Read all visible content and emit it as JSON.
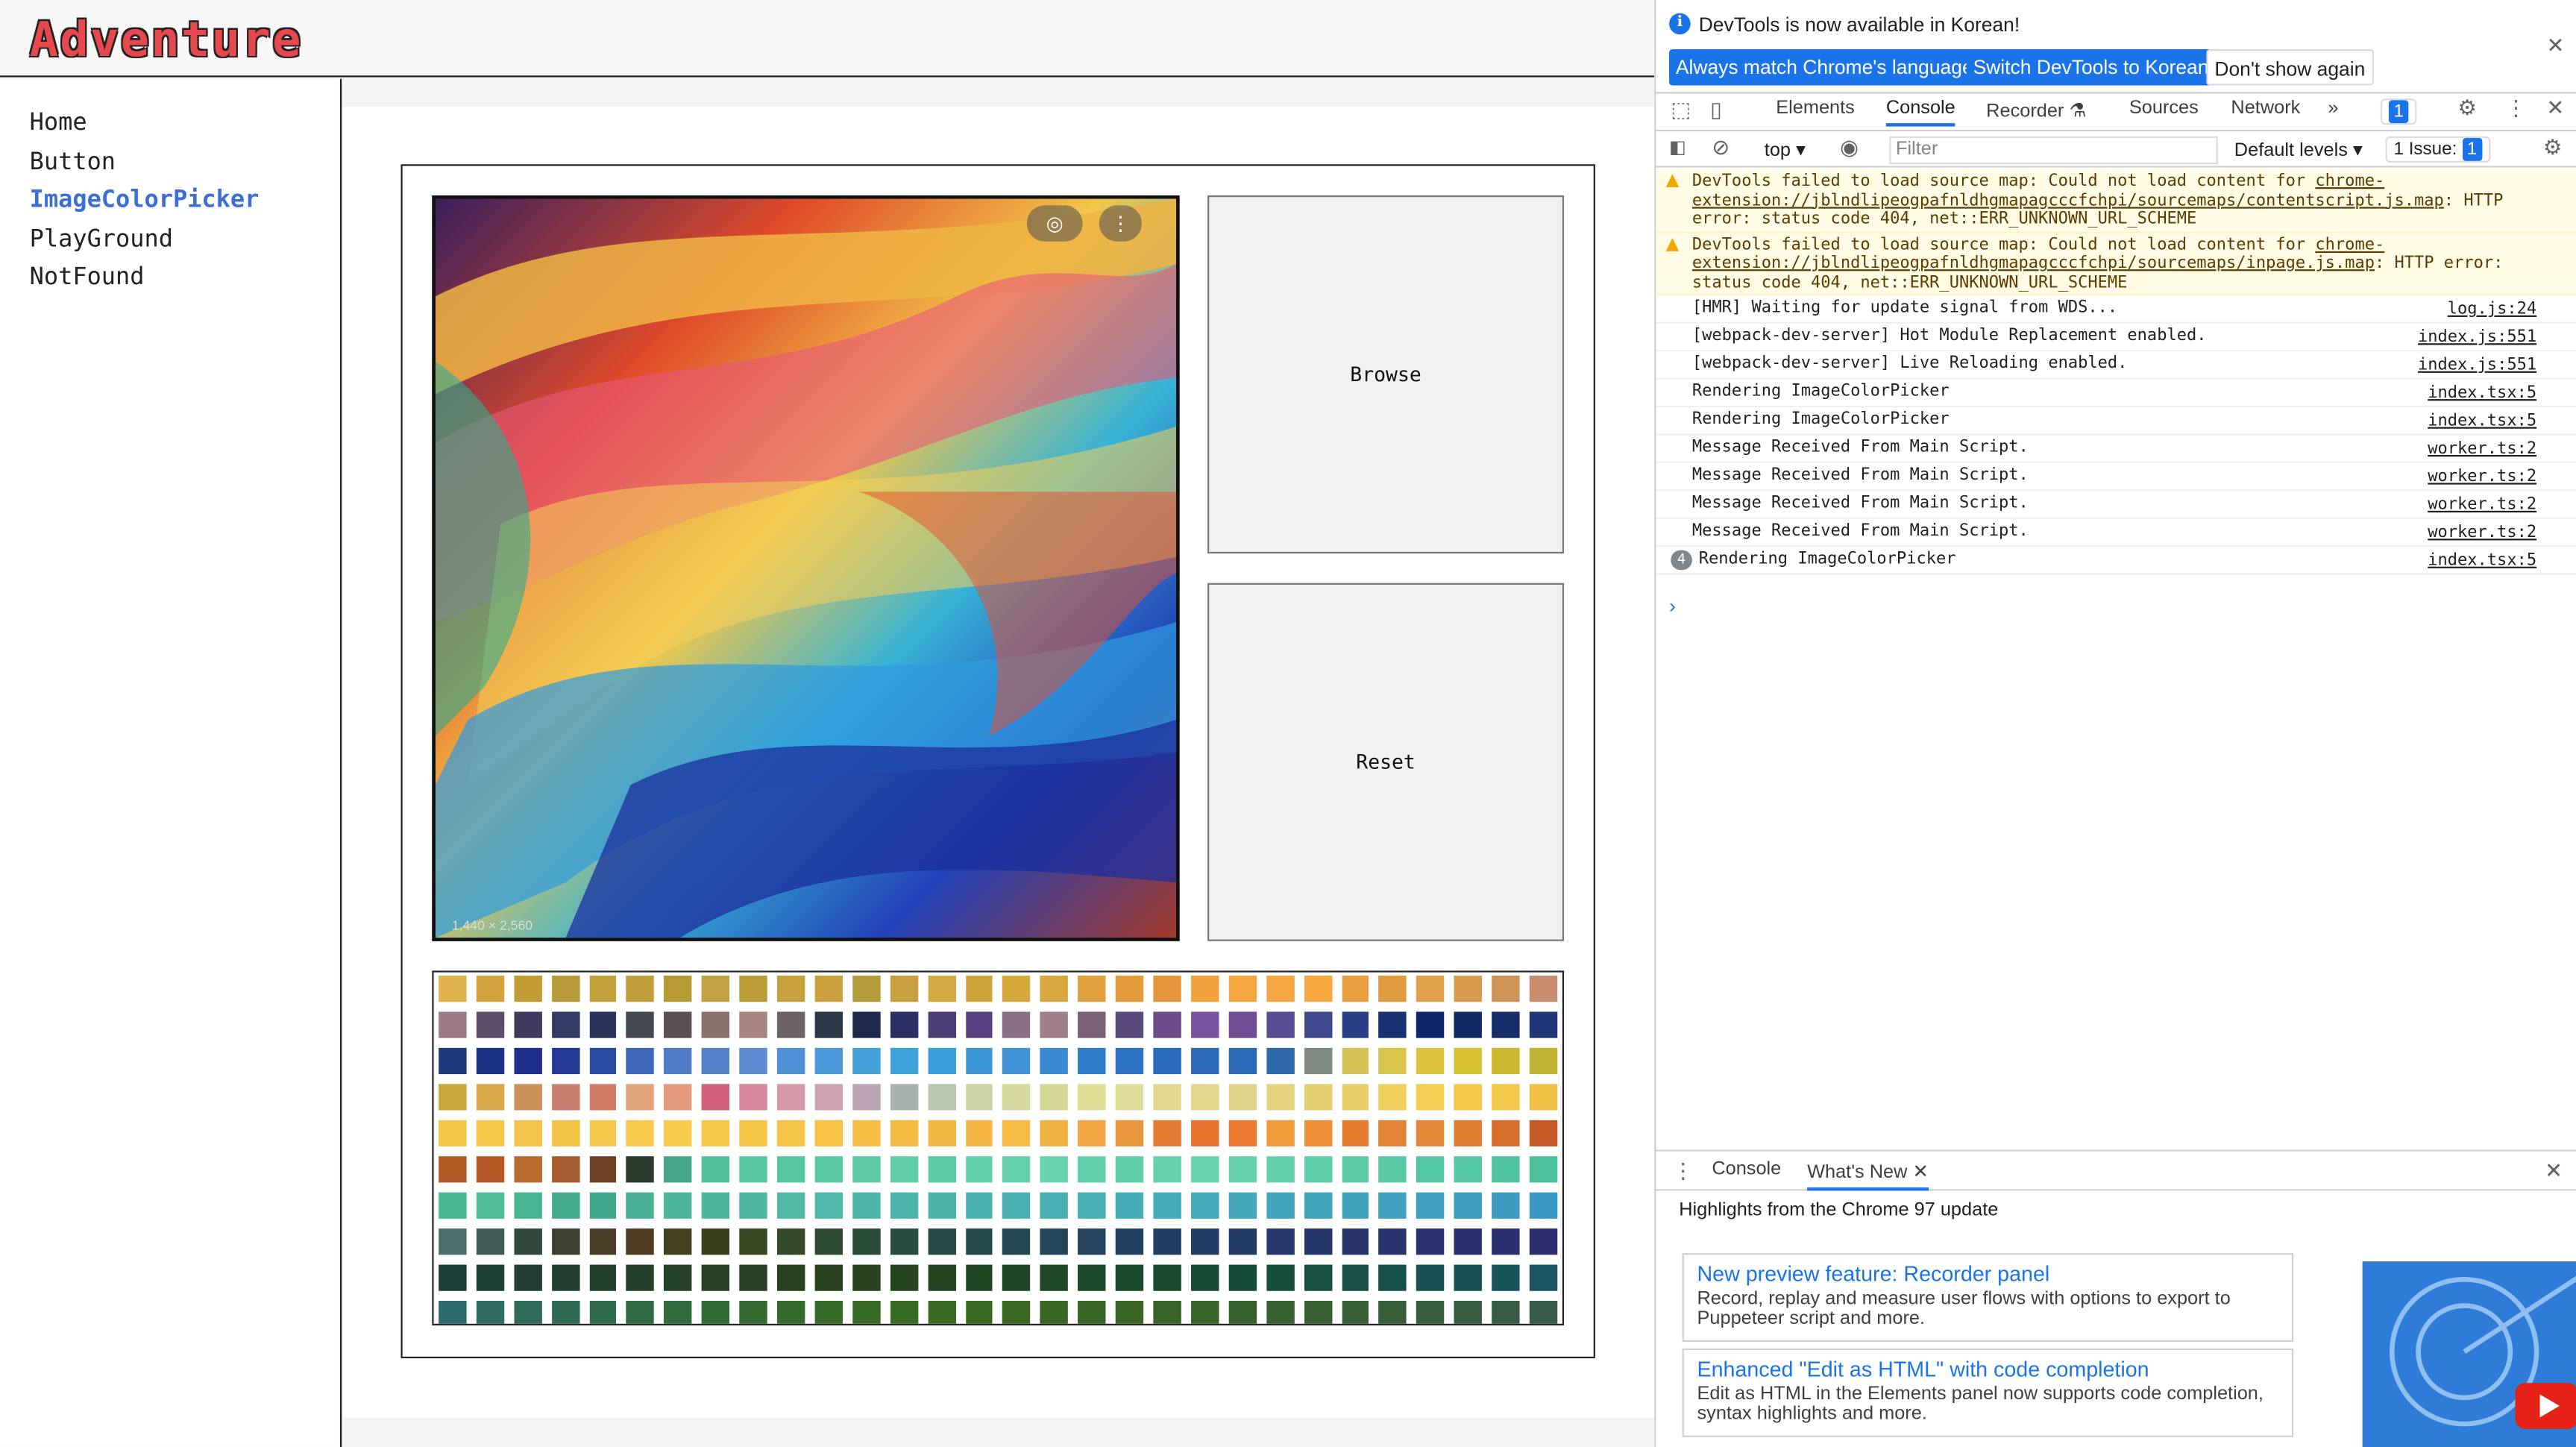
{
  "app": {
    "brand": "Adventure",
    "nav": [
      {
        "label": "Home",
        "active": false
      },
      {
        "label": "Button",
        "active": false
      },
      {
        "label": "ImageColorPicker",
        "active": true
      },
      {
        "label": "PlayGround",
        "active": false
      },
      {
        "label": "NotFound",
        "active": false
      }
    ],
    "picker": {
      "image_size_label": "1,440 × 2,560",
      "browse_label": "Browse",
      "reset_label": "Reset",
      "palette_rows": [
        [
          "#e0b44c",
          "#d3a43d",
          "#c29c33",
          "#b79b3a",
          "#c1a03a",
          "#c09e3a",
          "#b59a34",
          "#bfa043",
          "#b99c36",
          "#c7a13c",
          "#caa13d",
          "#b69b3a",
          "#c8a03f",
          "#d3a943",
          "#cda43a",
          "#d5a83c",
          "#d9a740",
          "#dfa03d",
          "#e39b3c",
          "#e5963c",
          "#f2a23c",
          "#f5a742",
          "#f6a744",
          "#f7a83f",
          "#e89f3e",
          "#df9c3e",
          "#e2a04b",
          "#d89b4d",
          "#cf9257",
          "#c88d6f"
        ],
        [
          "#9a7a86",
          "#5c4e6b",
          "#3f3b5f",
          "#2f3b63",
          "#2a335a",
          "#444851",
          "#5c4f55",
          "#8a6f6b",
          "#a7847d",
          "#6d6268",
          "#2c3848",
          "#1d2a4c",
          "#2a2f64",
          "#4d3d77",
          "#584080",
          "#8b6f88",
          "#9f7f88",
          "#7a5f79",
          "#5a4a7c",
          "#6c4c89",
          "#7c53a0",
          "#714d95",
          "#5a4c93",
          "#3e4a8d",
          "#283e86",
          "#173173",
          "#10266c",
          "#0f2a63",
          "#182c6c",
          "#213677"
        ],
        [
          "#1e3a7a",
          "#1a3283",
          "#1f2d8d",
          "#233894",
          "#2a4ba3",
          "#3d67b8",
          "#4e7cc8",
          "#5382cb",
          "#5c8bd4",
          "#4f90d7",
          "#4a99da",
          "#46a1db",
          "#3fa2dd",
          "#3c9edc",
          "#3d96d5",
          "#3f95d7",
          "#3a8ad3",
          "#2f7dcb",
          "#2e73c5",
          "#2b6bbf",
          "#2e6ab9",
          "#2c6ab7",
          "#2e6aa9",
          "#7f8b83",
          "#d6c155",
          "#d9c44c",
          "#dcc43b",
          "#d8c233",
          "#cdb92e",
          "#c0b532"
        ],
        [
          "#c9a73a",
          "#d8a94a",
          "#c9905a",
          "#c88070",
          "#d27c66",
          "#e3a47a",
          "#e39b7c",
          "#d0607a",
          "#d8849a",
          "#d79aa8",
          "#cda3b2",
          "#bca5b4",
          "#a8b0b0",
          "#b8c7ad",
          "#c9d3a5",
          "#d7d89e",
          "#d6d796",
          "#dfdd96",
          "#e2dc99",
          "#e3d891",
          "#e5d88d",
          "#e1d389",
          "#e6d37f",
          "#e4ce6f",
          "#e8ce67",
          "#f0cf5d",
          "#f4cd52",
          "#f3c947",
          "#f2c74a",
          "#f0c144"
        ],
        [
          "#f2c647",
          "#f6c649",
          "#f2c44a",
          "#f1c244",
          "#f4c64a",
          "#f7c94c",
          "#f8cb4d",
          "#f8c84a",
          "#f6c546",
          "#f5c447",
          "#f6c145",
          "#f4bf44",
          "#f2bb42",
          "#f3b844",
          "#f5b643",
          "#f7ba45",
          "#f1b244",
          "#f0a642",
          "#ea963d",
          "#e47c33",
          "#e8752f",
          "#ec7c32",
          "#f19b3a",
          "#f08e36",
          "#e87d30",
          "#e28336",
          "#e3863a",
          "#e17c33",
          "#d86e2d",
          "#c45b26"
        ],
        [
          "#b05a26",
          "#b85a27",
          "#b86a2f",
          "#a45b2e",
          "#6e4125",
          "#2a3b2c",
          "#46a68a",
          "#52c09c",
          "#56c7a1",
          "#55c6a0",
          "#5ac9a4",
          "#5ecaa6",
          "#62cda9",
          "#5acba6",
          "#60cfab",
          "#63d1ad",
          "#68d3b0",
          "#62cfac",
          "#5fcdaa",
          "#64d0ad",
          "#6ad4b2",
          "#66d2af",
          "#63d0ad",
          "#5ecdaa",
          "#5ccba8",
          "#59c9a6",
          "#55c6a3",
          "#56c7a4",
          "#52c3a1",
          "#4cbf9d"
        ],
        [
          "#49b890",
          "#4fbc95",
          "#47b594",
          "#45ab8e",
          "#3fa88c",
          "#4ab095",
          "#4eb49a",
          "#4eb59e",
          "#4fb6a1",
          "#50b8a5",
          "#4fb7a7",
          "#4eb6a9",
          "#4db5ab",
          "#4cb4ad",
          "#4bb3b0",
          "#49b1b2",
          "#48b0b4",
          "#47aeb5",
          "#46acb6",
          "#45abb8",
          "#44a9b9",
          "#43a8ba",
          "#42a6bb",
          "#41a5bc",
          "#40a3bd",
          "#3fa1be",
          "#3e9fbf",
          "#3d9dbf",
          "#3c9bc0",
          "#3b99c1"
        ],
        [
          "#4d6d6a",
          "#3e5c55",
          "#324a3e",
          "#3a3f2e",
          "#4a3a28",
          "#4b3922",
          "#43401f",
          "#3a401e",
          "#374622",
          "#344a29",
          "#2f4c31",
          "#2b4b39",
          "#294b40",
          "#264a46",
          "#24494c",
          "#234752",
          "#224557",
          "#22435b",
          "#22405f",
          "#223e62",
          "#233c65",
          "#243a67",
          "#253869",
          "#26366b",
          "#27356c",
          "#28336d",
          "#29326e",
          "#2a306e",
          "#2b2f6f",
          "#2c2e6f"
        ],
        [
          "#1f3e3a",
          "#203f36",
          "#213f33",
          "#224030",
          "#23402d",
          "#24402a",
          "#254127",
          "#264124",
          "#274122",
          "#284220",
          "#28421f",
          "#27431f",
          "#264420",
          "#244521",
          "#224622",
          "#204724",
          "#1e4826",
          "#1c4929",
          "#1a4a2c",
          "#194b30",
          "#184c34",
          "#174d38",
          "#164e3d",
          "#164f42",
          "#165047",
          "#16514c",
          "#165251",
          "#175356",
          "#17545b",
          "#185560"
        ],
        [
          "#2c6a6b",
          "#2d6b63",
          "#2e6b5b",
          "#2f6b53",
          "#306b4b",
          "#316b44",
          "#326b3d",
          "#336b37",
          "#346b31",
          "#356b2c",
          "#366b28",
          "#376b25",
          "#386b23",
          "#386a22",
          "#386922",
          "#386822",
          "#386723",
          "#386624",
          "#386526",
          "#386428",
          "#38632a",
          "#38622d",
          "#386130",
          "#386033",
          "#385f36",
          "#385e39",
          "#385d3d",
          "#385c41",
          "#385b45",
          "#385a49"
        ]
      ]
    }
  },
  "devtools": {
    "infobar": {
      "message": "DevTools is now available in Korean!",
      "buttons": [
        "Always match Chrome's language",
        "Switch DevTools to Korean",
        "Don't show again"
      ]
    },
    "tabs": [
      "Elements",
      "Console",
      "Recorder",
      "Sources",
      "Network"
    ],
    "active_tab": "Console",
    "more_tabs": "»",
    "message_badge": "1",
    "context": "top",
    "filter_placeholder": "Filter",
    "levels": "Default levels",
    "issues_label": "1 Issue:",
    "issues_count": "1",
    "console": [
      {
        "type": "warn",
        "text": "DevTools failed to load source map: Could not load content for ",
        "link": "chrome-extension://jblndlipeogpafnldhgmapagcccfchpi/sourcemaps/contentscript.js.map",
        "tail": ": HTTP error: status code 404, net::ERR_UNKNOWN_URL_SCHEME",
        "source": ""
      },
      {
        "type": "warn",
        "text": "DevTools failed to load source map: Could not load content for ",
        "link": "chrome-extension://jblndlipeogpafnldhgmapagcccfchpi/sourcemaps/inpage.js.map",
        "tail": ": HTTP error: status code 404, net::ERR_UNKNOWN_URL_SCHEME",
        "source": ""
      },
      {
        "type": "log",
        "text": "[HMR] Waiting for update signal from WDS...",
        "source": "log.js:24"
      },
      {
        "type": "log",
        "text": "[webpack-dev-server] Hot Module Replacement enabled.",
        "source": "index.js:551"
      },
      {
        "type": "log",
        "text": "[webpack-dev-server] Live Reloading enabled.",
        "source": "index.js:551"
      },
      {
        "type": "log",
        "text": "Rendering ImageColorPicker",
        "source": "index.tsx:5"
      },
      {
        "type": "log",
        "text": "Rendering ImageColorPicker",
        "source": "index.tsx:5"
      },
      {
        "type": "log",
        "text": "Message Received From Main Script.",
        "source": "worker.ts:2"
      },
      {
        "type": "log",
        "text": "Message Received From Main Script.",
        "source": "worker.ts:2"
      },
      {
        "type": "log",
        "text": "Message Received From Main Script.",
        "source": "worker.ts:2"
      },
      {
        "type": "log",
        "text": "Message Received From Main Script.",
        "source": "worker.ts:2"
      },
      {
        "type": "log",
        "count": "4",
        "text": "Rendering ImageColorPicker",
        "source": "index.tsx:5"
      }
    ],
    "drawer": {
      "tabs": [
        "Console",
        "What's New"
      ],
      "active_tab": "What's New",
      "highlight": "Highlights from the Chrome 97 update",
      "features": [
        {
          "title": "New preview feature: Recorder panel",
          "desc": "Record, replay and measure user flows with options to export to Puppeteer script and more."
        },
        {
          "title": "Enhanced \"Edit as HTML\" with code completion",
          "desc": "Edit as HTML in the Elements panel now supports code completion, syntax highlights and more."
        }
      ]
    }
  }
}
